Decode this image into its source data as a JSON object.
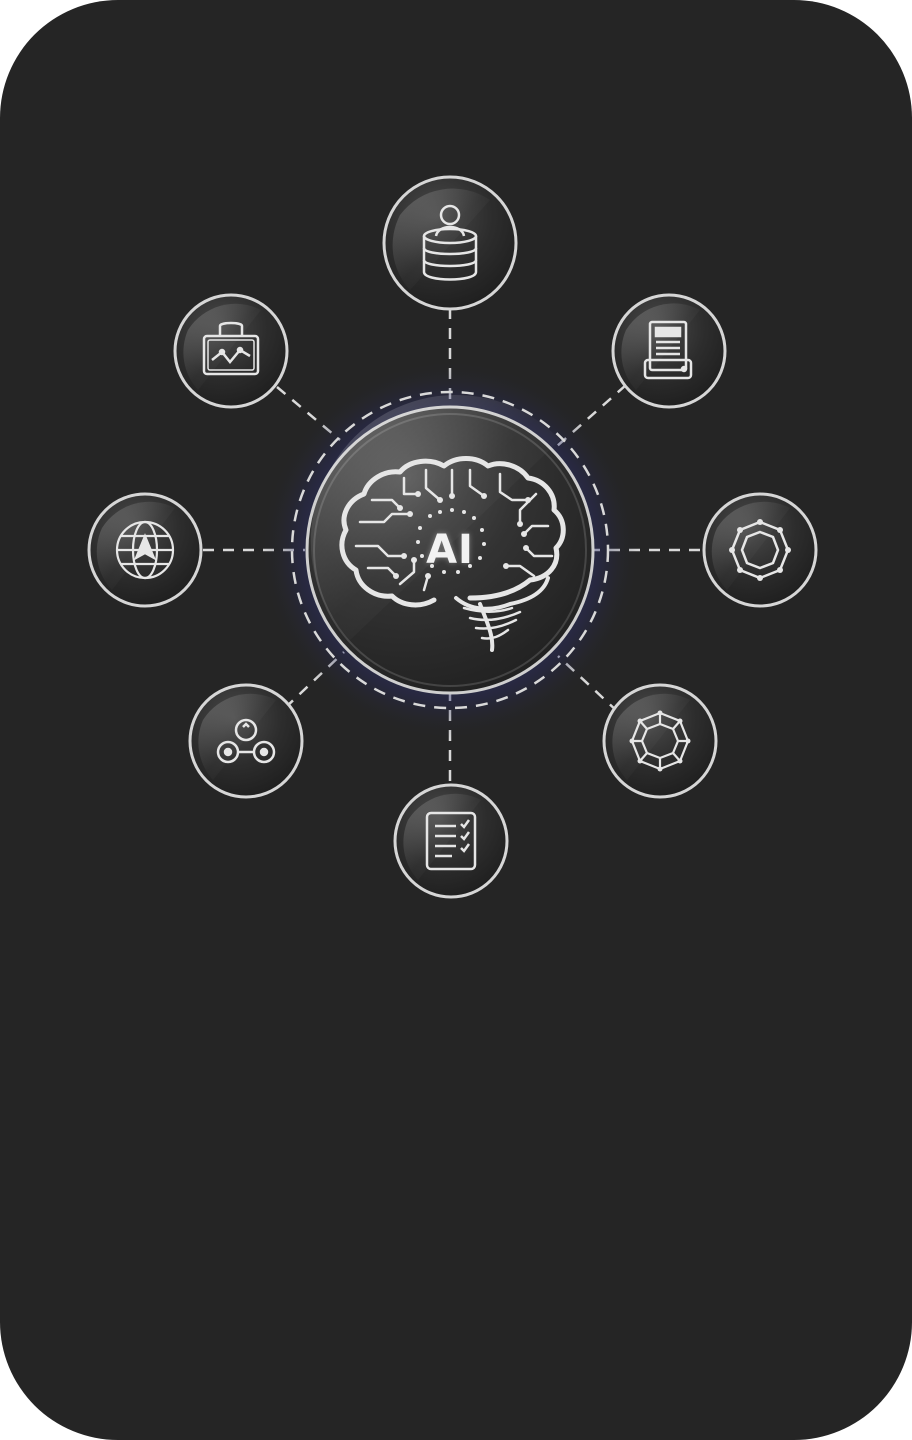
{
  "hub": {
    "label": "AI",
    "icon": "brain-circuit-icon"
  },
  "nodes": [
    {
      "position": "top",
      "icon": "database-user-icon"
    },
    {
      "position": "top-right",
      "icon": "printer-document-icon"
    },
    {
      "position": "right",
      "icon": "network-polygon-icon"
    },
    {
      "position": "bottom-right",
      "icon": "mesh-network-icon"
    },
    {
      "position": "bottom",
      "icon": "checklist-document-icon"
    },
    {
      "position": "bottom-left",
      "icon": "connected-nodes-icon"
    },
    {
      "position": "left",
      "icon": "globe-navigation-icon"
    },
    {
      "position": "top-left",
      "icon": "briefcase-chart-icon"
    }
  ],
  "colors": {
    "background": "#252525",
    "glow": "#2e2f6e",
    "line": "#d9d9d9"
  }
}
